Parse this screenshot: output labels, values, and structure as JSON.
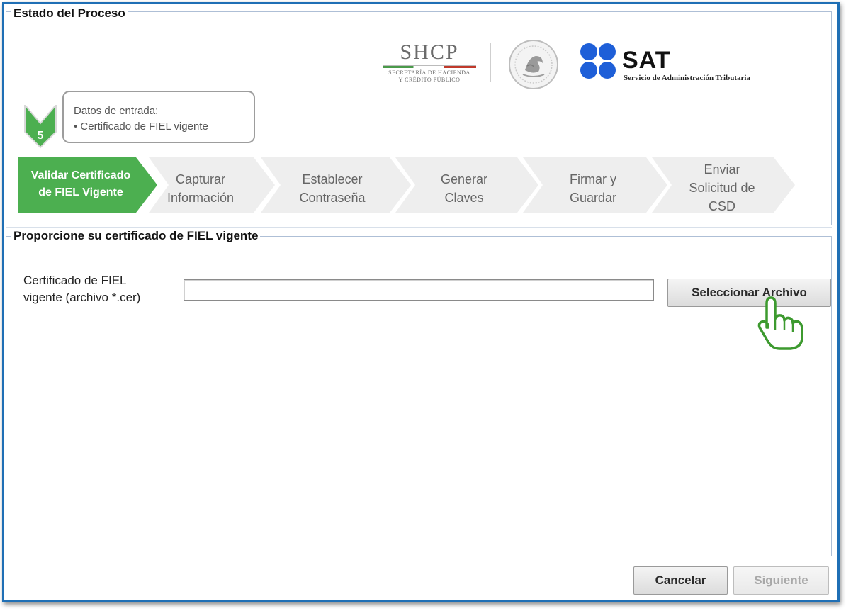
{
  "colors": {
    "frame_border": "#1f6fb5",
    "active_step": "#4caf50",
    "inactive_step": "#eeeeee",
    "sat_blue": "#1e5fd8"
  },
  "status_section": {
    "legend": "Estado del Proceso"
  },
  "logos": {
    "shcp_title": "SHCP",
    "shcp_line1": "SECRETARÍA DE HACIENDA",
    "shcp_line2": "Y CRÉDITO PÚBLICO",
    "seal_icon": "mexican-seal-icon",
    "sat_title": "SAT",
    "sat_subtitle": "Servicio de Administración Tributaria"
  },
  "step_indicator": {
    "number": "5",
    "info_title": "Datos de entrada:",
    "info_item": "• Certificado de FIEL vigente"
  },
  "process_steps": [
    {
      "line1": "Validar Certificado",
      "line2": "de FIEL Vigente",
      "line3": "",
      "active": true
    },
    {
      "line1": "Capturar",
      "line2": "Información",
      "line3": "",
      "active": false
    },
    {
      "line1": "Establecer",
      "line2": "Contraseña",
      "line3": "",
      "active": false
    },
    {
      "line1": "Generar",
      "line2": "Claves",
      "line3": "",
      "active": false
    },
    {
      "line1": "Firmar y",
      "line2": "Guardar",
      "line3": "",
      "active": false
    },
    {
      "line1": "Enviar",
      "line2": "Solicitud de",
      "line3": "CSD",
      "active": false
    }
  ],
  "certificate_section": {
    "legend": "Proporcione su certificado de FIEL vigente",
    "field_label_line1": "Certificado de FIEL",
    "field_label_line2": "vigente (archivo *.cer)",
    "field_value": "",
    "select_button": "Seleccionar Archivo"
  },
  "footer": {
    "cancel_button": "Cancelar",
    "next_button": "Siguiente"
  }
}
